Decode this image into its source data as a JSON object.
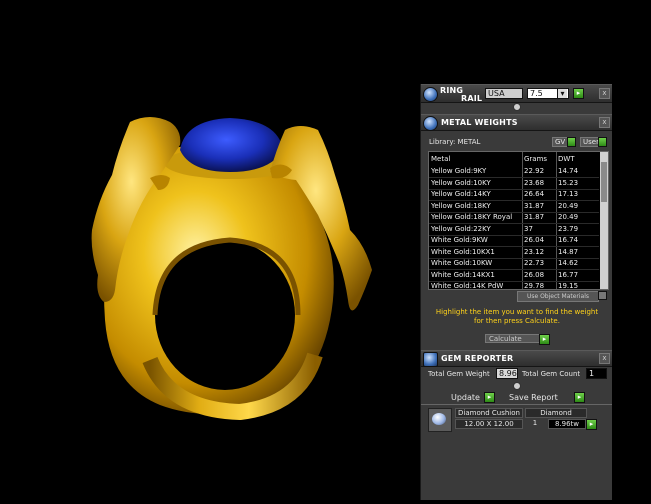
{
  "ring_rail": {
    "title_line1": "RING",
    "title_line2": "RAIL",
    "country": "USA",
    "size": "7.5",
    "size_arrow": "▾",
    "go": "▸",
    "close": "x"
  },
  "metal_weights": {
    "title": "METAL WEIGHTS",
    "close": "x",
    "library_label": "Library: METAL",
    "gv_label": "GV",
    "user_label": "User",
    "columns": [
      "Metal",
      "Grams",
      "DWT"
    ],
    "rows": [
      {
        "metal": "Yellow Gold:9KY",
        "grams": "22.92",
        "dwt": "14.74"
      },
      {
        "metal": "Yellow Gold:10KY",
        "grams": "23.68",
        "dwt": "15.23"
      },
      {
        "metal": "Yellow Gold:14KY",
        "grams": "26.64",
        "dwt": "17.13"
      },
      {
        "metal": "Yellow Gold:18KY",
        "grams": "31.87",
        "dwt": "20.49"
      },
      {
        "metal": "Yellow Gold:18KY Royal",
        "grams": "31.87",
        "dwt": "20.49"
      },
      {
        "metal": "Yellow Gold:22KY",
        "grams": "37",
        "dwt": "23.79"
      },
      {
        "metal": "White Gold:9KW",
        "grams": "26.04",
        "dwt": "16.74"
      },
      {
        "metal": "White Gold:10KX1",
        "grams": "23.12",
        "dwt": "14.87"
      },
      {
        "metal": "White Gold:10KW",
        "grams": "22.73",
        "dwt": "14.62"
      },
      {
        "metal": "White Gold:14KX1",
        "grams": "26.08",
        "dwt": "16.77"
      },
      {
        "metal": "White Gold:14K PdW",
        "grams": "29.78",
        "dwt": "19.15"
      }
    ],
    "use_object_materials": "Use Object Materials",
    "instruction": "Highlight the item you want to find the weight for then press Calculate.",
    "calculate": "Calculate",
    "go": "▸"
  },
  "gem_reporter": {
    "title": "GEM REPORTER",
    "close": "x",
    "total_weight_label": "Total Gem Weight",
    "total_weight_value": "8.96",
    "total_count_label": "Total Gem Count",
    "total_count_value": "1",
    "update": "Update",
    "save_report": "Save Report",
    "go": "▸",
    "gem": {
      "name": "Diamond Cushion",
      "size": "12.00 X 12.00",
      "material": "Diamond",
      "count": "1",
      "weight": "8.96tw"
    }
  },
  "colors": {
    "gold": "#e0ad12",
    "gem_blue": "#1a2fb8",
    "panel_bg": "#3a3a3a",
    "accent_green": "#3fae22",
    "instruction_yellow": "#ffd21a"
  }
}
